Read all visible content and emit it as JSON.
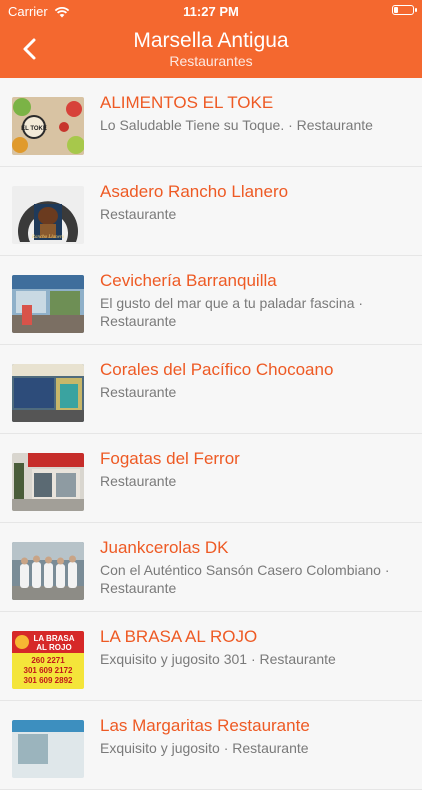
{
  "status": {
    "carrier": "Carrier",
    "time": "11:27 PM"
  },
  "header": {
    "title": "Marsella Antigua",
    "subtitle": "Restaurantes"
  },
  "items": [
    {
      "title": "ALIMENTOS EL TOKE",
      "subtitle": "Lo Saludable Tiene su Toque. · Restaurante"
    },
    {
      "title": "Asadero Rancho Llanero",
      "subtitle": "Restaurante"
    },
    {
      "title": "Cevichería Barranquilla",
      "subtitle": "El gusto del mar que a tu paladar fascina · Restaurante"
    },
    {
      "title": "Corales del Pacífico Chocoano",
      "subtitle": "Restaurante"
    },
    {
      "title": "Fogatas del Ferror",
      "subtitle": "Restaurante"
    },
    {
      "title": "Juankcerolas DK",
      "subtitle": "Con el Auténtico Sansón Casero Colombiano · Restaurante"
    },
    {
      "title": "LA BRASA AL ROJO",
      "subtitle": "Exquisito y jugosito 301 · Restaurante"
    },
    {
      "title": "Las Margaritas Restaurante",
      "subtitle": "Exquisito y jugosito · Restaurante"
    }
  ],
  "thumbs": {
    "t0": {
      "logo": "EL TOKE"
    },
    "t1": {
      "logo": "Rancho Llanero"
    },
    "t6": {
      "line1": "LA BRASA",
      "line2": "AL ROJO",
      "p1": "260 2271",
      "p2": "301 609 2172",
      "p3": "301 609 2892"
    }
  },
  "colors": {
    "accent": "#f4682f",
    "title": "#ee5a24",
    "subtitle": "#7a7a7a"
  }
}
